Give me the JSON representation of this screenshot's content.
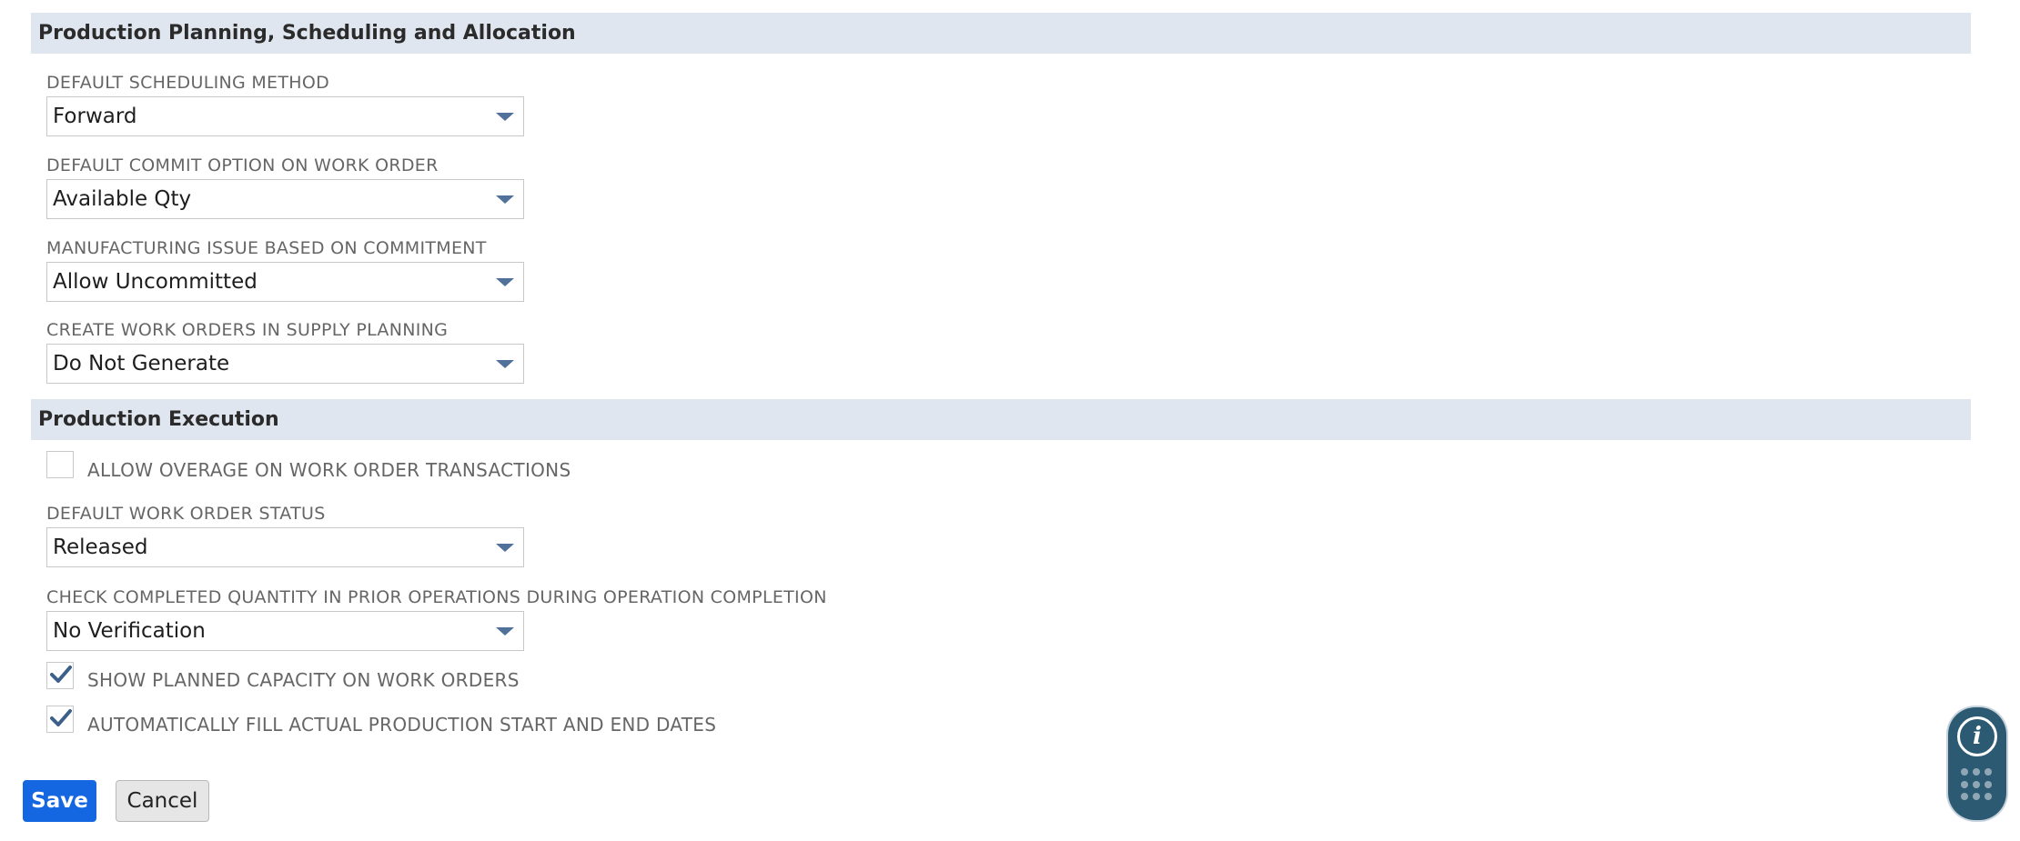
{
  "sections": {
    "planning_title": "Production Planning, Scheduling and Allocation",
    "execution_title": "Production Execution"
  },
  "planning": {
    "scheduling_method": {
      "label": "DEFAULT SCHEDULING METHOD",
      "value": "Forward"
    },
    "commit_option": {
      "label": "DEFAULT COMMIT OPTION ON WORK ORDER",
      "value": "Available Qty"
    },
    "issue_commitment": {
      "label": "MANUFACTURING ISSUE BASED ON COMMITMENT",
      "value": "Allow Uncommitted"
    },
    "supply_planning": {
      "label": "CREATE WORK ORDERS IN SUPPLY PLANNING",
      "value": "Do Not Generate"
    }
  },
  "execution": {
    "allow_overage": {
      "label": "ALLOW OVERAGE ON WORK ORDER TRANSACTIONS",
      "checked": false
    },
    "work_order_status": {
      "label": "DEFAULT WORK ORDER STATUS",
      "value": "Released"
    },
    "check_completed": {
      "label": "CHECK COMPLETED QUANTITY IN PRIOR OPERATIONS DURING OPERATION COMPLETION",
      "value": "No Verification"
    },
    "show_capacity": {
      "label": "SHOW PLANNED CAPACITY ON WORK ORDERS",
      "checked": true
    },
    "auto_fill_dates": {
      "label": "AUTOMATICALLY FILL ACTUAL PRODUCTION START AND END DATES",
      "checked": true
    }
  },
  "buttons": {
    "save": "Save",
    "cancel": "Cancel"
  },
  "help_widget": {
    "info_glyph": "i",
    "icons": [
      "info-icon",
      "grid-dots-icon"
    ]
  },
  "colors": {
    "section_bg": "#e0e6ef",
    "save_bg": "#1467e0",
    "caret": "#51709a",
    "check": "#3d5f8a",
    "widget_bg": "#2c5a73"
  }
}
